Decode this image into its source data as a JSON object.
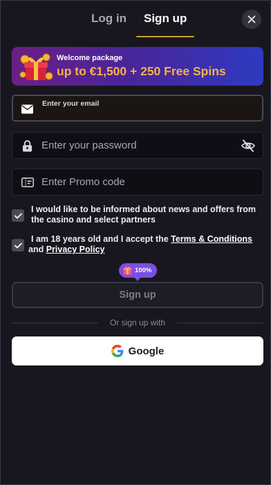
{
  "tabs": {
    "login": "Log in",
    "signup": "Sign up"
  },
  "banner": {
    "title": "Welcome package",
    "offer": "up to €1,500 + 250 Free Spins",
    "offer_color": "#f7b04a"
  },
  "fields": {
    "email_label": "Enter your email",
    "email_value": "",
    "password_placeholder": "Enter your password",
    "promo_placeholder": "Enter Promo code"
  },
  "consents": {
    "news": {
      "checked": true,
      "text": "I would like to be informed about news and offers from the casino and select partners"
    },
    "age": {
      "checked": true,
      "text_before": "I am 18 years old and I accept the ",
      "terms_link": "Terms & Conditions",
      "and": " and ",
      "privacy_link": "Privacy Policy"
    }
  },
  "badge": {
    "text": "100%",
    "color": "#7a4fe0"
  },
  "signup_button": "Sign up",
  "divider_text": "Or sign up with",
  "google_button": "Google",
  "icons": {
    "close": "close-icon",
    "gift": "gift-box-icon",
    "email": "envelope-icon",
    "password": "lock-icon",
    "eye": "eye-off-icon",
    "promo": "ticket-icon",
    "google": "google-logo-icon"
  },
  "colors": {
    "accent_underline": "#c9a32e",
    "background": "#18171f"
  }
}
